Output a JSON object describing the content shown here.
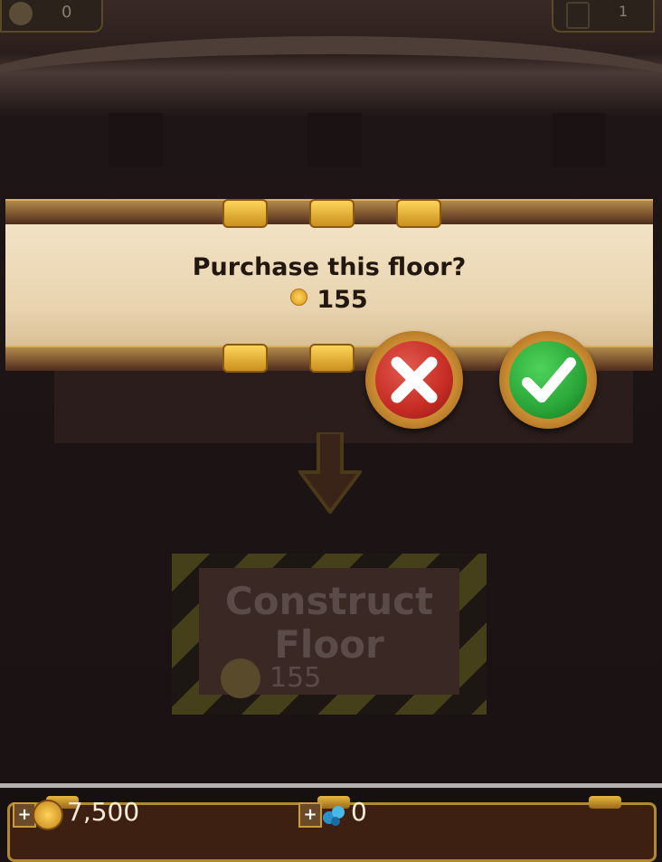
{
  "hud": {
    "top_left_value": "0",
    "top_right_value": "1"
  },
  "dialog": {
    "question": "Purchase this floor?",
    "price": "155"
  },
  "construct": {
    "line1": "Construct",
    "line2": "Floor",
    "cost": "155"
  },
  "bottom_bar": {
    "gold": "7,500",
    "gems": "0",
    "plus": "+"
  },
  "colors": {
    "confirm": "#2aa638",
    "cancel": "#c62c24",
    "parchment": "#f2e3c6"
  }
}
